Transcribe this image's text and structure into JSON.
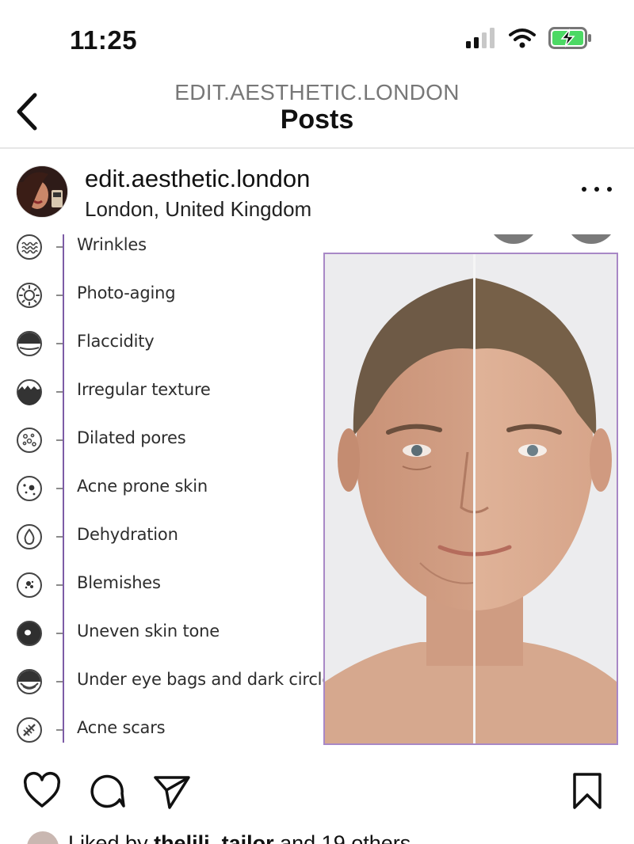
{
  "status_bar": {
    "time": "11:25",
    "icons": [
      "cellular-signal-icon",
      "wifi-icon",
      "battery-charging-icon"
    ],
    "battery_color": "#4cd964"
  },
  "nav": {
    "account": "EDIT.AESTHETIC.LONDON",
    "title": "Posts"
  },
  "post": {
    "username": "edit.aesthetic.london",
    "location": "London, United Kingdom",
    "image": {
      "frame_color": "#a888c6",
      "line_color": "#7d5ca6",
      "concerns": [
        {
          "label": "Wrinkles",
          "icon": "wrinkles-icon"
        },
        {
          "label": "Photo-aging",
          "icon": "sun-icon"
        },
        {
          "label": "Flaccidity",
          "icon": "flaccidity-icon"
        },
        {
          "label": "Irregular texture",
          "icon": "texture-icon"
        },
        {
          "label": "Dilated pores",
          "icon": "pores-icon"
        },
        {
          "label": "Acne prone skin",
          "icon": "acne-icon"
        },
        {
          "label": "Dehydration",
          "icon": "droplet-icon"
        },
        {
          "label": "Blemishes",
          "icon": "blemish-icon"
        },
        {
          "label": "Uneven skin tone",
          "icon": "skin-tone-icon"
        },
        {
          "label": "Under eye bags and dark circles",
          "icon": "eye-bag-icon"
        },
        {
          "label": "Acne scars",
          "icon": "scar-icon"
        }
      ]
    },
    "actions": [
      "heart-icon",
      "comment-icon",
      "share-icon",
      "bookmark-icon"
    ],
    "liked_by": {
      "prefix": "Liked by ",
      "user": "thelili_tailor",
      "suffix": " and 19 others"
    }
  }
}
